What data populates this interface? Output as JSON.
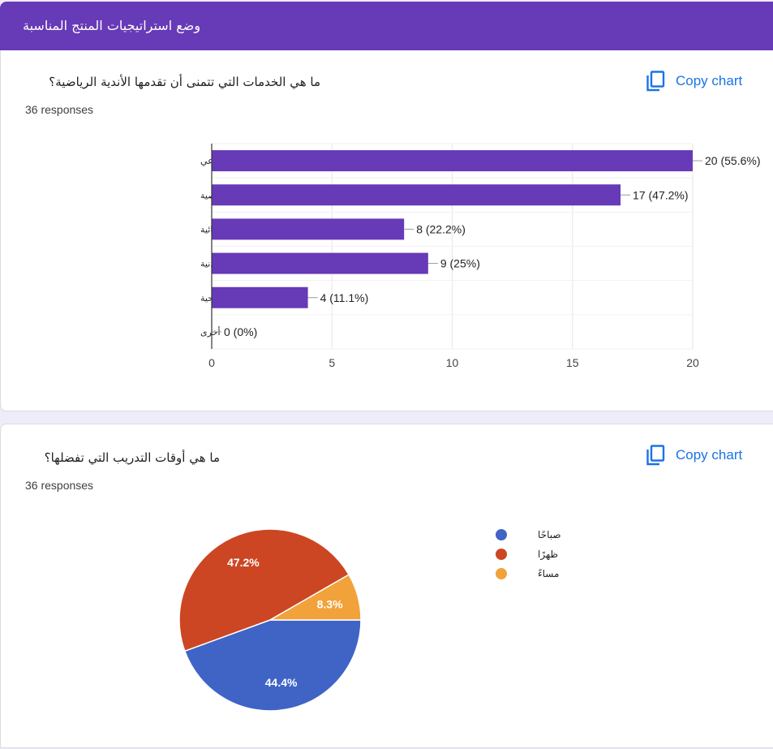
{
  "header": {
    "title": "وضع استراتيجيات المنتج المناسبة"
  },
  "copy_label": "Copy chart",
  "colors": {
    "header": "#673ab7",
    "bar": "#673ab7",
    "accent": "#1a73e8"
  },
  "questions": [
    {
      "title": "ما هي الخدمات التي تتمنى أن تقدمها الأندية الرياضية؟",
      "responses": "36 responses"
    },
    {
      "title": "ما هي أوقات التدريب التي تفضلها؟",
      "responses": "36 responses"
    }
  ],
  "chart_data": [
    {
      "type": "bar",
      "orientation": "horizontal",
      "categories": [
        "برامج تدريب جماعي",
        "جلسات تدريب شخصية",
        "استشارات غذائية",
        "تقييمات لياقة بدنية",
        "ورش عمل صحية",
        "أخرى"
      ],
      "values": [
        20,
        17,
        8,
        9,
        4,
        0
      ],
      "data_labels": [
        "20 (55.6%)",
        "17 (47.2%)",
        "8 (22.2%)",
        "9 (25%)",
        "4 (11.1%)",
        "0 (0%)"
      ],
      "xlim": [
        0,
        20
      ],
      "x_ticks": [
        "0",
        "5",
        "10",
        "15",
        "20"
      ],
      "grid": true,
      "color": "#673ab7"
    },
    {
      "type": "pie",
      "slices": [
        {
          "label": "صباحًا",
          "value": 44.4,
          "display": "44.4%",
          "color": "#3f64c6"
        },
        {
          "label": "ظهرًا",
          "value": 47.2,
          "display": "47.2%",
          "color": "#cc4624"
        },
        {
          "label": "مساءً",
          "value": 8.3,
          "display": "8.3%",
          "color": "#f2a23a"
        }
      ],
      "legend": "right"
    }
  ]
}
